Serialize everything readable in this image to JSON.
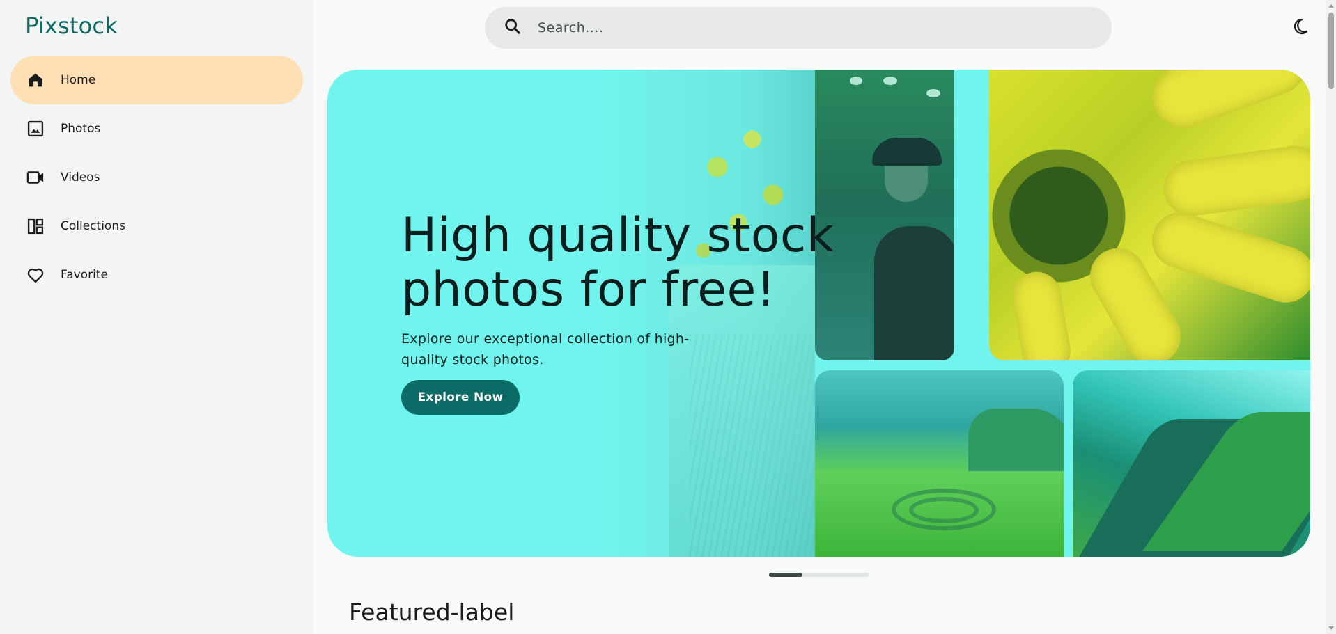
{
  "app": {
    "logo": "Pixstock",
    "accent_color": "#0b6b66",
    "active_nav_bg": "#ffdfb4"
  },
  "sidebar": {
    "items": [
      {
        "label": "Home",
        "icon": "home-icon",
        "active": true
      },
      {
        "label": "Photos",
        "icon": "photo-icon",
        "active": false
      },
      {
        "label": "Videos",
        "icon": "videocam-icon",
        "active": false
      },
      {
        "label": "Collections",
        "icon": "collections-icon",
        "active": false
      },
      {
        "label": "Favorite",
        "icon": "heart-icon",
        "active": false
      }
    ]
  },
  "search": {
    "placeholder": "Search....",
    "icon": "search-icon"
  },
  "header": {
    "theme_toggle_icon": "moon-icon"
  },
  "hero": {
    "title_line1": "High quality stock",
    "title_line2": "photos for free!",
    "subtitle": "Explore our exceptional collection of high-quality stock photos.",
    "cta_label": "Explore Now",
    "background_color": "#72f4ee"
  },
  "carousel": {
    "progress": 0.33
  },
  "featured": {
    "label": "Featured-label"
  }
}
